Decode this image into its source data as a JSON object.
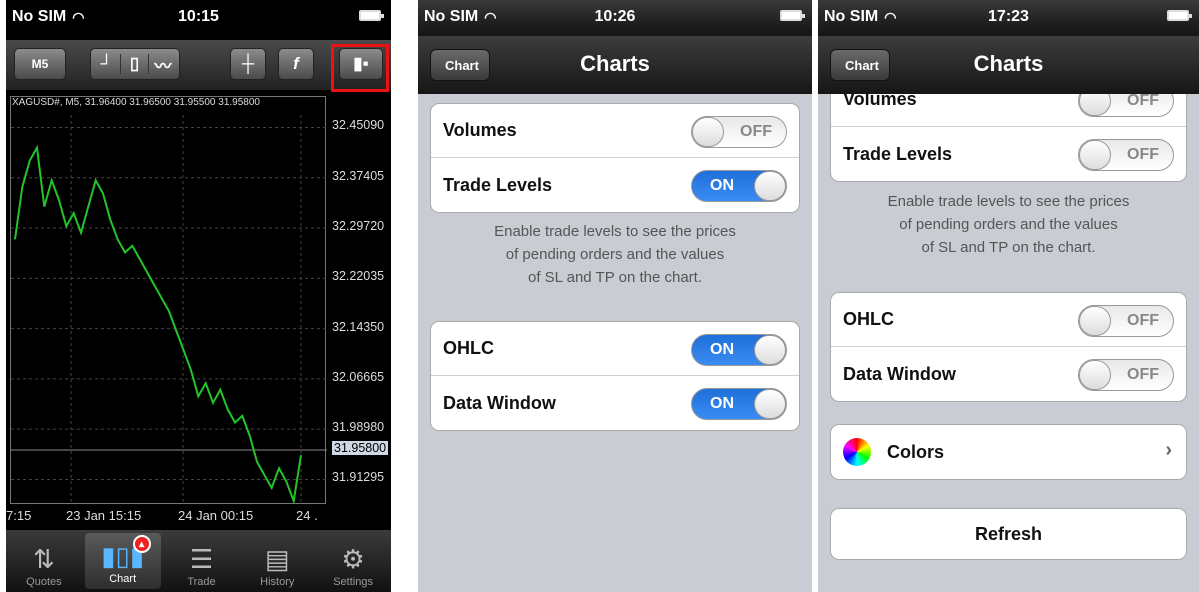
{
  "phone1": {
    "status": {
      "carrier": "No SIM",
      "time": "10:15"
    },
    "toolbar": {
      "timeframe": "M5",
      "chart_type_icons": [
        "bar-chart-icon",
        "candlestick-icon",
        "line-chart-icon"
      ],
      "crosshair_icon": "crosshair-icon",
      "indicators_label": "f",
      "settings_icon": "chart-settings-icon"
    },
    "chart": {
      "header": "XAGUSD#, M5, 31.96400 31.96500 31.95500 31.95800",
      "line_color": "#22c42a",
      "current_price": "31.95800"
    },
    "chart_data": {
      "type": "line",
      "title": "XAGUSD#, M5",
      "series": [
        {
          "values": [
            32.28,
            32.36,
            32.4,
            32.42,
            32.33,
            32.37,
            32.34,
            32.3,
            32.32,
            32.29,
            32.33,
            32.37,
            32.35,
            32.31,
            32.28,
            32.26,
            32.27,
            32.25,
            32.23,
            32.21,
            32.19,
            32.17,
            32.14,
            32.11,
            32.08,
            32.04,
            32.06,
            32.03,
            32.05,
            32.02,
            32.0,
            32.01,
            31.98,
            31.94,
            31.92,
            31.9,
            31.93,
            31.91,
            31.88,
            31.95
          ]
        }
      ],
      "yticks": [
        "32.45090",
        "32.37405",
        "32.29720",
        "32.22035",
        "32.14350",
        "32.06665",
        "31.98980",
        "31.91295"
      ],
      "xticks": [
        "7:15",
        "23 Jan 15:15",
        "24 Jan 00:15",
        "24 ."
      ],
      "ylim": [
        31.88,
        32.47
      ]
    },
    "tabs": [
      {
        "label": "Quotes",
        "icon": "quotes-icon",
        "glyph": "⇅"
      },
      {
        "label": "Chart",
        "icon": "chart-icon",
        "glyph": "▮▯▮"
      },
      {
        "label": "Trade",
        "icon": "trade-icon",
        "glyph": "☰"
      },
      {
        "label": "History",
        "icon": "history-icon",
        "glyph": "▤"
      },
      {
        "label": "Settings",
        "icon": "settings-gear-icon",
        "glyph": "⚙"
      }
    ]
  },
  "phone2": {
    "status": {
      "carrier": "No SIM",
      "time": "10:26"
    },
    "nav": {
      "back": "Chart",
      "title": "Charts"
    },
    "group1": [
      {
        "label": "Volumes",
        "state": "OFF"
      },
      {
        "label": "Trade Levels",
        "state": "ON"
      }
    ],
    "footnote": [
      "Enable trade levels to see the prices",
      "of pending orders and the values",
      "of SL and TP on the chart."
    ],
    "group2": [
      {
        "label": "OHLC",
        "state": "ON"
      },
      {
        "label": "Data Window",
        "state": "ON"
      }
    ]
  },
  "phone3": {
    "status": {
      "carrier": "No SIM",
      "time": "17:23"
    },
    "nav": {
      "back": "Chart",
      "title": "Charts"
    },
    "group1": [
      {
        "label": "Volumes",
        "state": "OFF"
      },
      {
        "label": "Trade Levels",
        "state": "OFF"
      }
    ],
    "footnote": [
      "Enable trade levels to see the prices",
      "of pending orders and the values",
      "of SL and TP on the chart."
    ],
    "group2": [
      {
        "label": "OHLC",
        "state": "OFF"
      },
      {
        "label": "Data Window",
        "state": "OFF"
      }
    ],
    "colors": {
      "label": "Colors",
      "icon": "color-wheel-icon"
    },
    "refresh": "Refresh"
  }
}
